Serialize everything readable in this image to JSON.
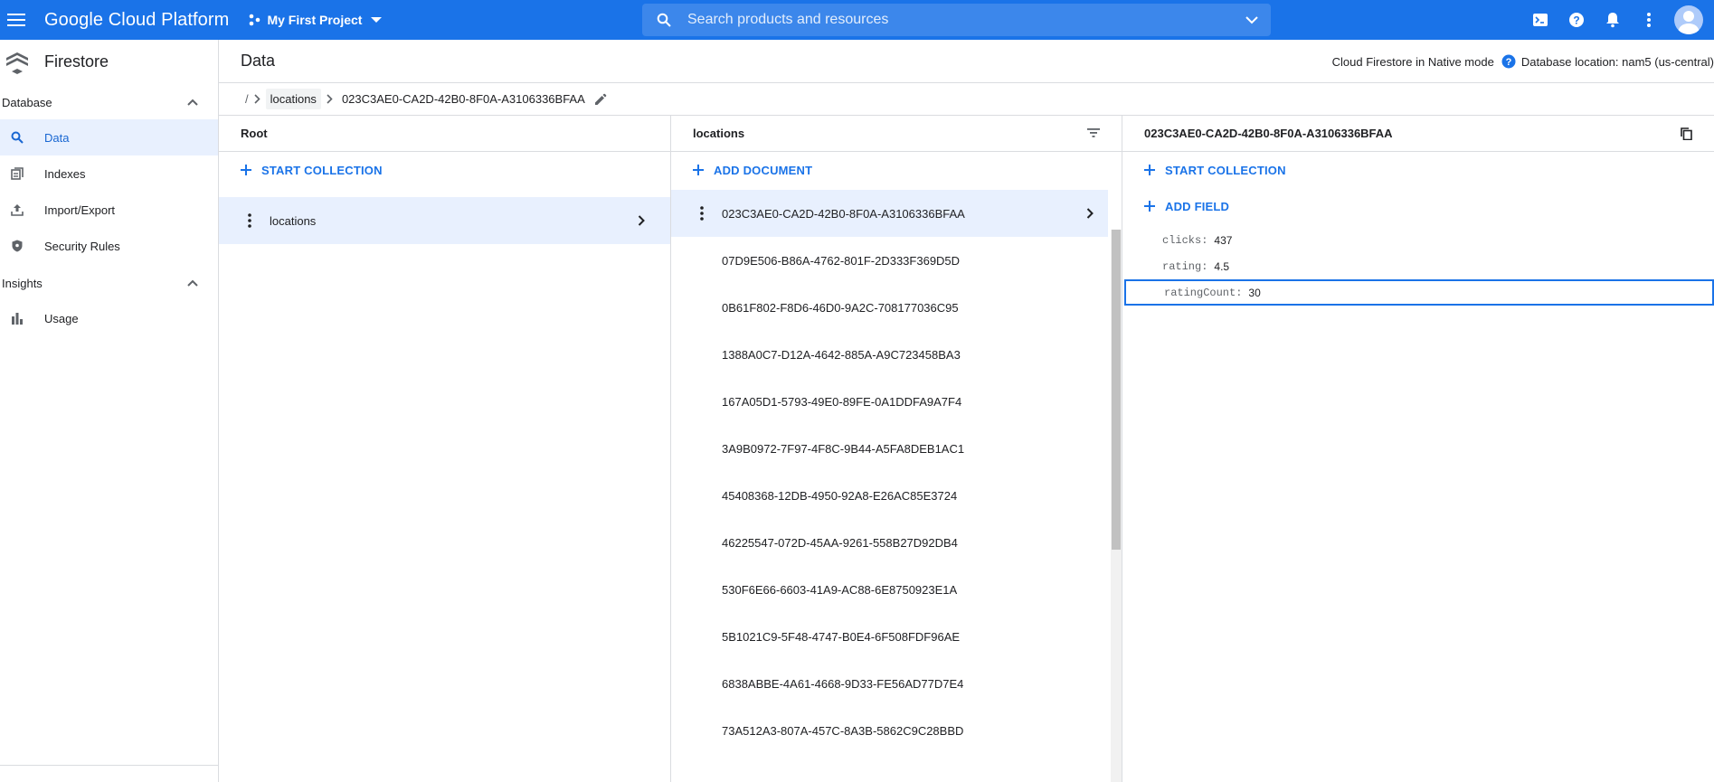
{
  "topbar": {
    "brand": "Google Cloud Platform",
    "project": "My First Project",
    "search_placeholder": "Search products and resources",
    "accent": "#1a73e8"
  },
  "sidebar": {
    "title": "Firestore",
    "sections": [
      {
        "label": "Database",
        "items": [
          {
            "label": "Data",
            "icon": "search-icon",
            "active": true
          },
          {
            "label": "Indexes",
            "icon": "indexes-icon"
          },
          {
            "label": "Import/Export",
            "icon": "upload-icon"
          },
          {
            "label": "Security Rules",
            "icon": "shield-icon"
          }
        ]
      },
      {
        "label": "Insights",
        "items": [
          {
            "label": "Usage",
            "icon": "bar-chart-icon"
          }
        ]
      }
    ]
  },
  "main": {
    "title": "Data",
    "mode": "Cloud Firestore in Native mode",
    "db_location": "Database location: nam5 (us-central)"
  },
  "breadcrumb": {
    "root": "/",
    "collection": "locations",
    "document": "023C3AE0-CA2D-42B0-8F0A-A3106336BFAA"
  },
  "root_panel": {
    "header": "Root",
    "action": "START COLLECTION",
    "collections": [
      "locations"
    ]
  },
  "collection_panel": {
    "header": "locations",
    "action": "ADD DOCUMENT",
    "documents": [
      "023C3AE0-CA2D-42B0-8F0A-A3106336BFAA",
      "07D9E506-B86A-4762-801F-2D333F369D5D",
      "0B61F802-F8D6-46D0-9A2C-708177036C95",
      "1388A0C7-D12A-4642-885A-A9C723458BA3",
      "167A05D1-5793-49E0-89FE-0A1DDFA9A7F4",
      "3A9B0972-7F97-4F8C-9B44-A5FA8DEB1AC1",
      "45408368-12DB-4950-92A8-E26AC85E3724",
      "46225547-072D-45AA-9261-558B27D92DB4",
      "530F6E66-6603-41A9-AC88-6E8750923E1A",
      "5B1021C9-5F48-4747-B0E4-6F508FDF96AE",
      "6838ABBE-4A61-4668-9D33-FE56AD77D7E4",
      "73A512A3-807A-457C-8A3B-5862C9C28BBD"
    ]
  },
  "document_panel": {
    "header": "023C3AE0-CA2D-42B0-8F0A-A3106336BFAA",
    "action_collection": "START COLLECTION",
    "action_field": "ADD FIELD",
    "fields": [
      {
        "key": "clicks:",
        "value": "437"
      },
      {
        "key": "rating:",
        "value": "4.5"
      },
      {
        "key": "ratingCount:",
        "value": "30"
      }
    ]
  }
}
